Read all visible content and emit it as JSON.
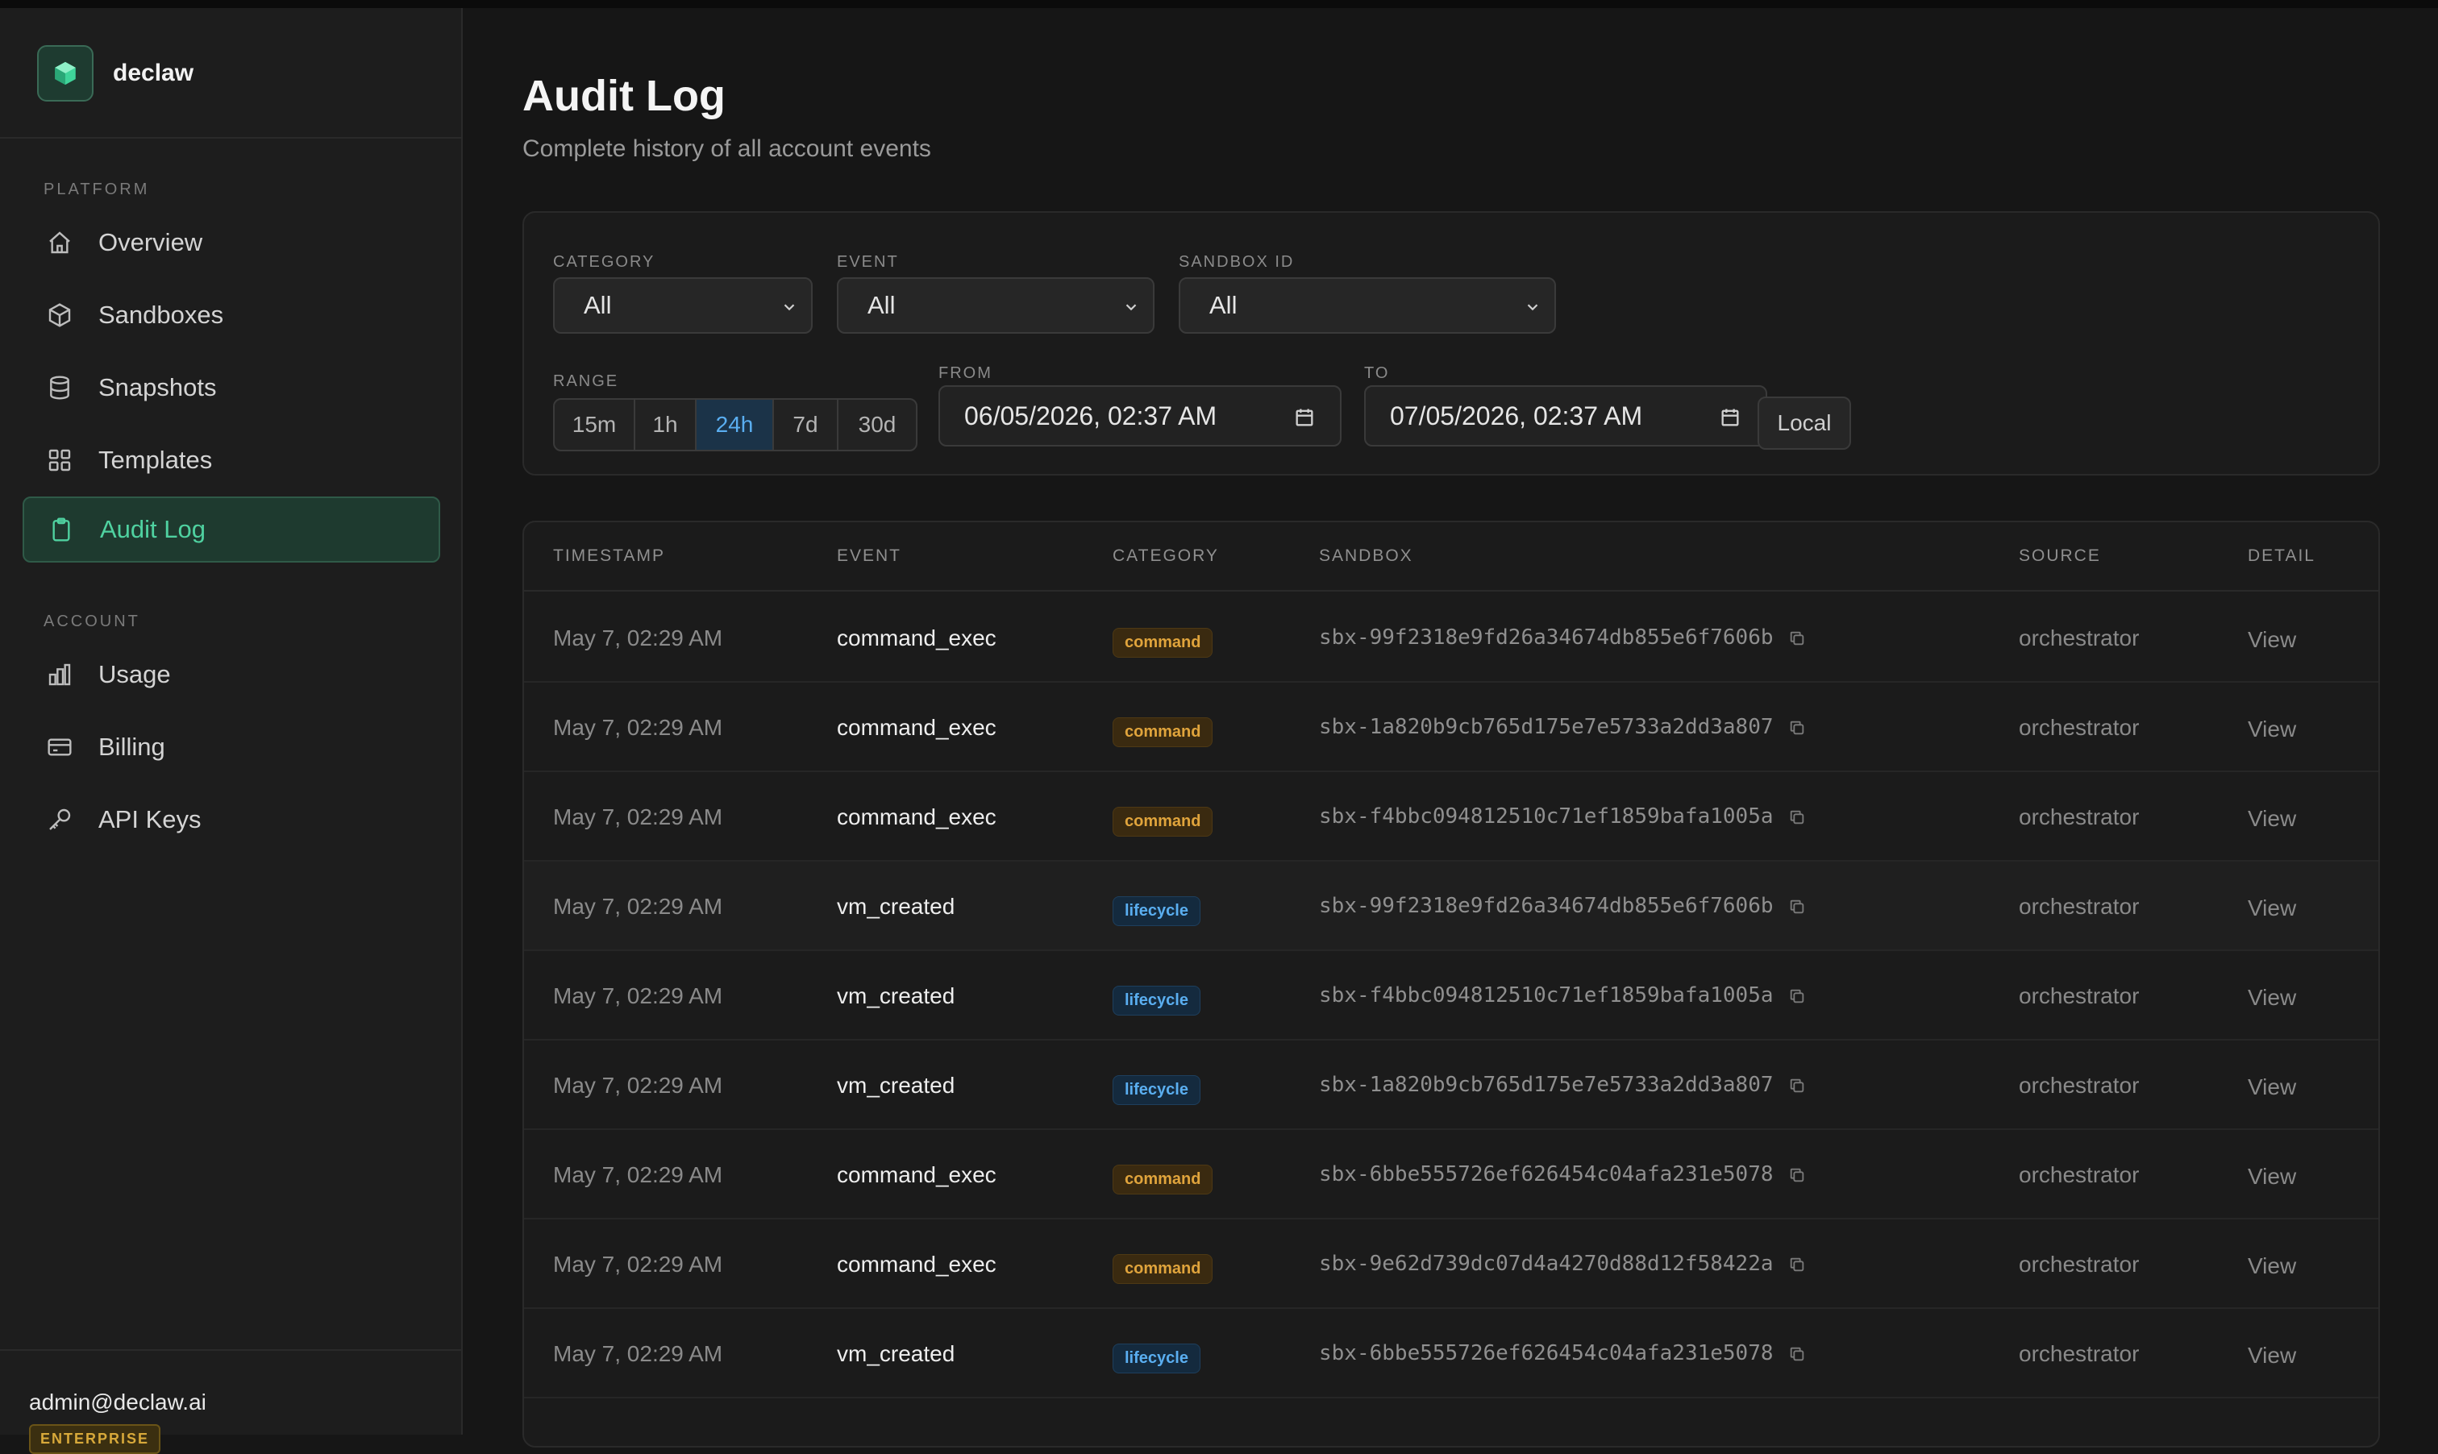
{
  "sidebar": {
    "brand": "declaw",
    "sections": {
      "platform": "PLATFORM",
      "account": "ACCOUNT"
    },
    "platform_items": [
      {
        "label": "Overview",
        "icon": "home-icon"
      },
      {
        "label": "Sandboxes",
        "icon": "cube-icon"
      },
      {
        "label": "Snapshots",
        "icon": "database-icon"
      },
      {
        "label": "Templates",
        "icon": "grid-icon"
      },
      {
        "label": "Audit Log",
        "icon": "clipboard-icon",
        "active": true
      }
    ],
    "account_items": [
      {
        "label": "Usage",
        "icon": "bar-chart-icon"
      },
      {
        "label": "Billing",
        "icon": "credit-card-icon"
      },
      {
        "label": "API Keys",
        "icon": "key-icon"
      }
    ],
    "user_email": "admin@declaw.ai",
    "plan_badge": "ENTERPRISE"
  },
  "page": {
    "title": "Audit Log",
    "subtitle": "Complete history of all account events"
  },
  "filters": {
    "category": {
      "label": "CATEGORY",
      "value": "All"
    },
    "event": {
      "label": "EVENT",
      "value": "All"
    },
    "sandbox": {
      "label": "SANDBOX ID",
      "value": "All"
    },
    "range": {
      "label": "RANGE",
      "options": [
        "15m",
        "1h",
        "24h",
        "7d",
        "30d"
      ],
      "selected": "24h"
    },
    "from": {
      "label": "FROM",
      "value": "06/05/2026, 02:37 AM"
    },
    "to": {
      "label": "TO",
      "value": "07/05/2026, 02:37 AM"
    },
    "timezone_button": "Local"
  },
  "table": {
    "columns": [
      "TIMESTAMP",
      "EVENT",
      "CATEGORY",
      "SANDBOX",
      "SOURCE",
      "DETAIL"
    ],
    "rows": [
      {
        "timestamp": "May 7, 02:29 AM",
        "event": "command_exec",
        "category": "command",
        "sandbox": "sbx-99f2318e9fd26a34674db855e6f7606b",
        "source": "orchestrator",
        "detail": "View"
      },
      {
        "timestamp": "May 7, 02:29 AM",
        "event": "command_exec",
        "category": "command",
        "sandbox": "sbx-1a820b9cb765d175e7e5733a2dd3a807",
        "source": "orchestrator",
        "detail": "View"
      },
      {
        "timestamp": "May 7, 02:29 AM",
        "event": "command_exec",
        "category": "command",
        "sandbox": "sbx-f4bbc094812510c71ef1859bafa1005a",
        "source": "orchestrator",
        "detail": "View"
      },
      {
        "timestamp": "May 7, 02:29 AM",
        "event": "vm_created",
        "category": "lifecycle",
        "sandbox": "sbx-99f2318e9fd26a34674db855e6f7606b",
        "source": "orchestrator",
        "detail": "View"
      },
      {
        "timestamp": "May 7, 02:29 AM",
        "event": "vm_created",
        "category": "lifecycle",
        "sandbox": "sbx-f4bbc094812510c71ef1859bafa1005a",
        "source": "orchestrator",
        "detail": "View"
      },
      {
        "timestamp": "May 7, 02:29 AM",
        "event": "vm_created",
        "category": "lifecycle",
        "sandbox": "sbx-1a820b9cb765d175e7e5733a2dd3a807",
        "source": "orchestrator",
        "detail": "View"
      },
      {
        "timestamp": "May 7, 02:29 AM",
        "event": "command_exec",
        "category": "command",
        "sandbox": "sbx-6bbe555726ef626454c04afa231e5078",
        "source": "orchestrator",
        "detail": "View"
      },
      {
        "timestamp": "May 7, 02:29 AM",
        "event": "command_exec",
        "category": "command",
        "sandbox": "sbx-9e62d739dc07d4a4270d88d12f58422a",
        "source": "orchestrator",
        "detail": "View"
      },
      {
        "timestamp": "May 7, 02:29 AM",
        "event": "vm_created",
        "category": "lifecycle",
        "sandbox": "sbx-6bbe555726ef626454c04afa231e5078",
        "source": "orchestrator",
        "detail": "View"
      }
    ]
  },
  "colors": {
    "accent_green": "#4fd1a0",
    "accent_blue": "#5aaef0",
    "command_orange": "#e0a43c"
  }
}
